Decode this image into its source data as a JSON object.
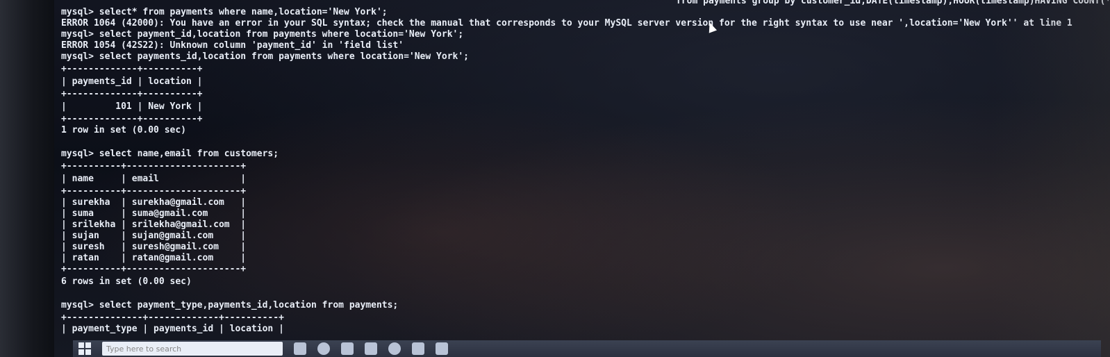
{
  "terminal": {
    "lines": [
      "mysql> select* from payments where name,location='New York';",
      "ERROR 1064 (42000): You have an error in your SQL syntax; check the manual that corresponds to your MySQL server version for the right syntax to use near ',location='New York'' at line 1",
      "mysql> select payment_id,location from payments where location='New York';",
      "ERROR 1054 (42S22): Unknown column 'payment_id' in 'field list'",
      "mysql> select payments_id,location from payments where location='New York';",
      "+-------------+----------+",
      "| payments_id | location |",
      "+-------------+----------+",
      "|         101 | New York |",
      "+-------------+----------+",
      "1 row in set (0.00 sec)",
      "",
      "mysql> select name,email from customers;",
      "+----------+---------------------+",
      "| name     | email               |",
      "+----------+---------------------+",
      "| surekha  | surekha@gmail.com   |",
      "| suma     | suma@gmail.com      |",
      "| srilekha | srilekha@gmail.com  |",
      "| sujan    | sujan@gmail.com     |",
      "| suresh   | suresh@gmail.com    |",
      "| ratan    | ratan@gmail.com     |",
      "+----------+---------------------+",
      "6 rows in set (0.00 sec)",
      "",
      "mysql> select payment_type,payments_id,location from payments;",
      "+--------------+-------------+----------+",
      "| payment_type | payments_id | location |"
    ],
    "top_partial": "from payments group by customer_id,DATE(timestamp),HOUR(timestamp)HAVING COUNT(*)>3;"
  },
  "taskbar": {
    "search_placeholder": "Type here to search"
  }
}
